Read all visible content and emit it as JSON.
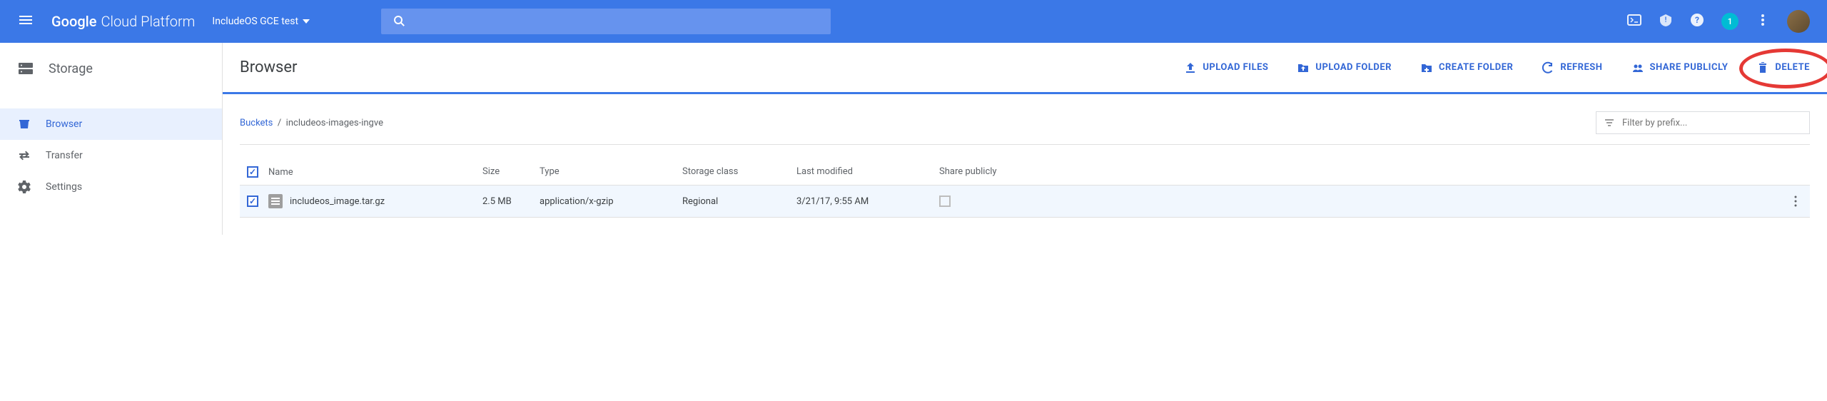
{
  "topbar": {
    "logo_google": "Google",
    "logo_cloud": "Cloud Platform",
    "project": "IncludeOS GCE test",
    "notification_count": "1"
  },
  "sidebar": {
    "title": "Storage",
    "items": [
      {
        "label": "Browser"
      },
      {
        "label": "Transfer"
      },
      {
        "label": "Settings"
      }
    ]
  },
  "actions": {
    "upload_files": "UPLOAD FILES",
    "upload_folder": "UPLOAD FOLDER",
    "create_folder": "CREATE FOLDER",
    "refresh": "REFRESH",
    "share_publicly": "SHARE PUBLICLY",
    "delete": "DELETE"
  },
  "content": {
    "title": "Browser",
    "breadcrumb_root": "Buckets",
    "breadcrumb_current": "includeos-images-ingve",
    "filter_placeholder": "Filter by prefix..."
  },
  "table": {
    "headers": {
      "name": "Name",
      "size": "Size",
      "type": "Type",
      "storage_class": "Storage class",
      "last_modified": "Last modified",
      "share_publicly": "Share publicly"
    },
    "rows": [
      {
        "name": "includeos_image.tar.gz",
        "size": "2.5 MB",
        "type": "application/x-gzip",
        "storage_class": "Regional",
        "last_modified": "3/21/17, 9:55 AM"
      }
    ]
  }
}
